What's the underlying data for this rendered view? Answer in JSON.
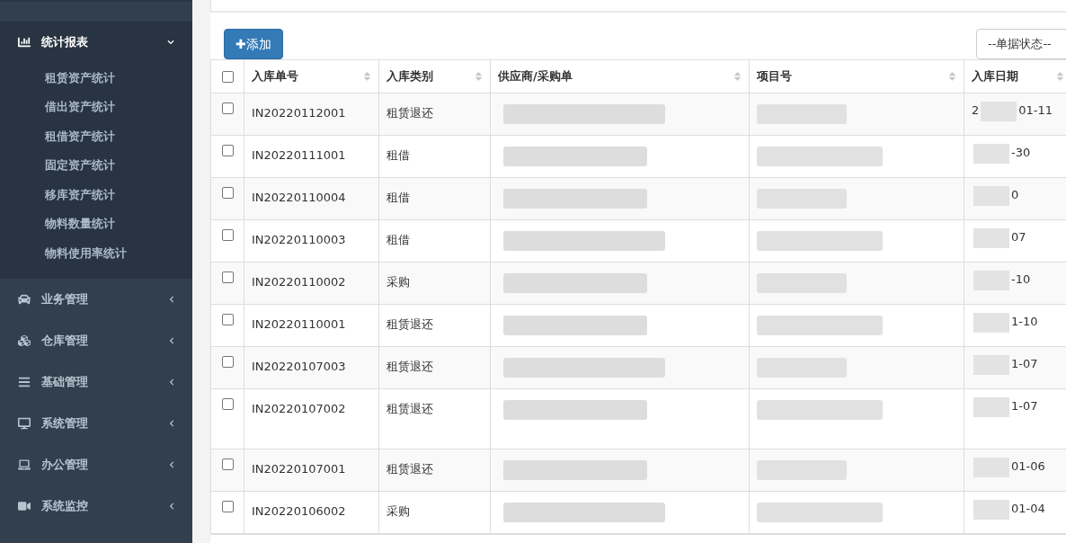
{
  "sidebar": {
    "sections": [
      {
        "label": "统计报表",
        "expanded": true,
        "children": [
          "租赁资产统计",
          "借出资产统计",
          "租借资产统计",
          "固定资产统计",
          "移库资产统计",
          "物料数量统计",
          "物料使用率统计"
        ]
      },
      {
        "label": "业务管理",
        "expanded": false
      },
      {
        "label": "仓库管理",
        "expanded": false
      },
      {
        "label": "基础管理",
        "expanded": false
      },
      {
        "label": "系统管理",
        "expanded": false
      },
      {
        "label": "办公管理",
        "expanded": false
      },
      {
        "label": "系统监控",
        "expanded": false
      }
    ]
  },
  "toolbar": {
    "add_button": "✚添加",
    "status_select": "--单据状态--"
  },
  "table": {
    "all_checked": false,
    "columns": [
      "入库单号",
      "入库类别",
      "供应商/采购单",
      "项目号",
      "入库日期"
    ],
    "rows": [
      {
        "checked": false,
        "number": "IN20220112001",
        "category": "租赁退还",
        "date_prefix": "2",
        "date": "01-11",
        "tall": false
      },
      {
        "checked": false,
        "number": "IN20220111001",
        "category": "租借",
        "date_prefix": "",
        "date": "-30",
        "tall": false
      },
      {
        "checked": false,
        "number": "IN20220110004",
        "category": "租借",
        "date_prefix": "",
        "date": "0",
        "tall": false
      },
      {
        "checked": false,
        "number": "IN20220110003",
        "category": "租借",
        "date_prefix": "",
        "date": "07",
        "tall": false
      },
      {
        "checked": false,
        "number": "IN20220110002",
        "category": "采购",
        "date_prefix": "",
        "date": "-10",
        "tall": false
      },
      {
        "checked": false,
        "number": "IN20220110001",
        "category": "租赁退还",
        "date_prefix": "",
        "date": "1-10",
        "tall": false
      },
      {
        "checked": false,
        "number": "IN20220107003",
        "category": "租赁退还",
        "date_prefix": "",
        "date": "1-07",
        "tall": false
      },
      {
        "checked": false,
        "number": "IN20220107002",
        "category": "租赁退还",
        "date_prefix": "",
        "date": "1-07",
        "tall": true
      },
      {
        "checked": false,
        "number": "IN20220107001",
        "category": "租赁退还",
        "date_prefix": "",
        "date": "01-06",
        "tall": false
      },
      {
        "checked": false,
        "number": "IN20220106002",
        "category": "采购",
        "date_prefix": "",
        "date": "01-04",
        "tall": false
      }
    ]
  }
}
